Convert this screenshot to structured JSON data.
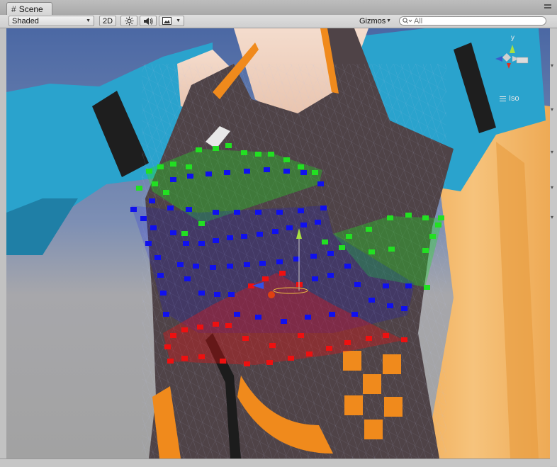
{
  "window": {
    "tab_label": "Scene",
    "tab_icon": "grid-icon",
    "menu_icon": "window-menu-icon"
  },
  "toolbar": {
    "shading_mode": "Shaded",
    "mode_2d": "2D",
    "light_icon": "sun-icon",
    "audio_icon": "speaker-icon",
    "effects_icon": "image-icon",
    "gizmos_label": "Gizmos",
    "search_placeholder": "All",
    "search_icon": "search-icon"
  },
  "orientation_gizmo": {
    "axis_label": "y",
    "projection_label": "Iso"
  },
  "colors": {
    "sky": "#5a75a8",
    "ground": "#a8a8a8",
    "sleeve": "#2aa3cd",
    "vest": "#4f4347",
    "accent_orange": "#f08a1c",
    "cloth_orange": "#f4b360",
    "handle_green": "#22e022",
    "handle_blue": "#1010ee",
    "handle_red": "#ee1010"
  }
}
